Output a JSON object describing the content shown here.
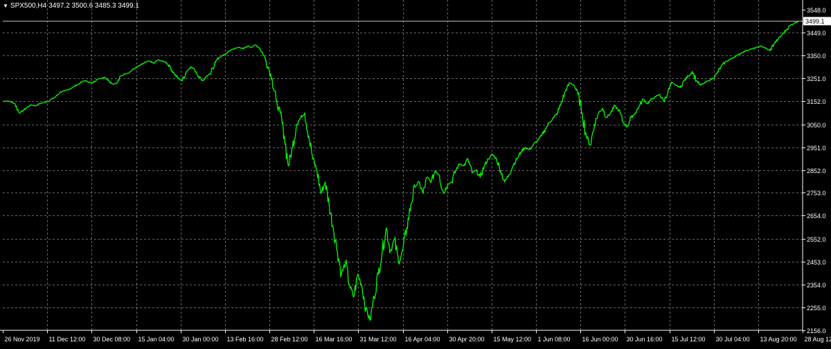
{
  "chart_title": {
    "symbol": "SPX500,H4",
    "ohlc": "3497.2 3500.6 3485.3 3499.1"
  },
  "colors": {
    "background": "#000000",
    "grid": "#c0c0c0",
    "axis": "#ffffff",
    "series": "#00ff00",
    "bid_line": "#c0c0c0",
    "price_label_bg": "#ffffff",
    "price_label_fg": "#000000"
  },
  "chart_data": {
    "type": "line",
    "ylim": [
      2156.0,
      3548.0
    ],
    "y_ticks": [
      3548.0,
      3449.0,
      3350.0,
      3251.0,
      3152.0,
      3050.0,
      2951.0,
      2852.0,
      2753.0,
      2654.0,
      2552.0,
      2453.0,
      2354.0,
      2255.0,
      2156.0
    ],
    "y_tick_labels": [
      "3548.0",
      "3449.0",
      "3350.0",
      "3251.0",
      "3152.0",
      "3050.0",
      "2951.0",
      "2852.0",
      "2753.0",
      "2654.0",
      "2552.0",
      "2453.0",
      "2354.0",
      "2255.0",
      "2156.0"
    ],
    "x_tick_labels": [
      "26 Nov 2019",
      "11 Dec 12:00",
      "30 Dec 08:00",
      "15 Jan 04:00",
      "30 Jan 00:00",
      "13 Feb 16:00",
      "28 Feb 12:00",
      "16 Mar 16:00",
      "31 Mar 12:00",
      "16 Apr 04:00",
      "30 Apr 20:00",
      "15 May 12:00",
      "1 Jun 08:00",
      "16 Jun 00:00",
      "30 Jun 16:00",
      "15 Jul 12:00",
      "30 Jul 04:00",
      "13 Aug 20:00",
      "28 Aug 12:00"
    ],
    "last_price": 3499.1,
    "last_price_label": "3499.1",
    "series": [
      {
        "values": [
          3150,
          3152,
          3148,
          3140,
          3100,
          3110,
          3125,
          3135,
          3130,
          3140,
          3145,
          3150,
          3160,
          3170,
          3190,
          3195,
          3200,
          3210,
          3220,
          3230,
          3240,
          3235,
          3230,
          3245,
          3250,
          3255,
          3240,
          3225,
          3230,
          3260,
          3270,
          3275,
          3290,
          3300,
          3310,
          3320,
          3325,
          3315,
          3330,
          3325,
          3320,
          3300,
          3270,
          3250,
          3240,
          3280,
          3300,
          3290,
          3260,
          3240,
          3260,
          3270,
          3320,
          3340,
          3350,
          3360,
          3375,
          3380,
          3385,
          3378,
          3390,
          3385,
          3395,
          3380,
          3350,
          3300,
          3250,
          3150,
          3100,
          3000,
          2870,
          2950,
          3050,
          3080,
          3100,
          3000,
          2900,
          2850,
          2750,
          2800,
          2700,
          2600,
          2500,
          2400,
          2450,
          2350,
          2300,
          2400,
          2350,
          2250,
          2200,
          2300,
          2400,
          2500,
          2600,
          2500,
          2550,
          2450,
          2500,
          2600,
          2700,
          2780,
          2800,
          2750,
          2820,
          2800,
          2850,
          2830,
          2750,
          2790,
          2800,
          2850,
          2880,
          2870,
          2900,
          2840,
          2850,
          2820,
          2870,
          2900,
          2920,
          2900,
          2850,
          2800,
          2830,
          2870,
          2900,
          2930,
          2950,
          2940,
          2960,
          2980,
          3000,
          3030,
          3060,
          3080,
          3100,
          3150,
          3200,
          3230,
          3220,
          3180,
          3100,
          3000,
          2960,
          3050,
          3100,
          3120,
          3080,
          3100,
          3130,
          3110,
          3060,
          3040,
          3080,
          3100,
          3130,
          3160,
          3140,
          3160,
          3170,
          3180,
          3150,
          3190,
          3230,
          3220,
          3210,
          3240,
          3260,
          3280,
          3240,
          3220,
          3230,
          3240,
          3250,
          3270,
          3300,
          3320,
          3330,
          3340,
          3350,
          3360,
          3370,
          3375,
          3380,
          3385,
          3390,
          3380,
          3370,
          3400,
          3420,
          3440,
          3460,
          3480,
          3490,
          3499.1
        ]
      }
    ]
  }
}
